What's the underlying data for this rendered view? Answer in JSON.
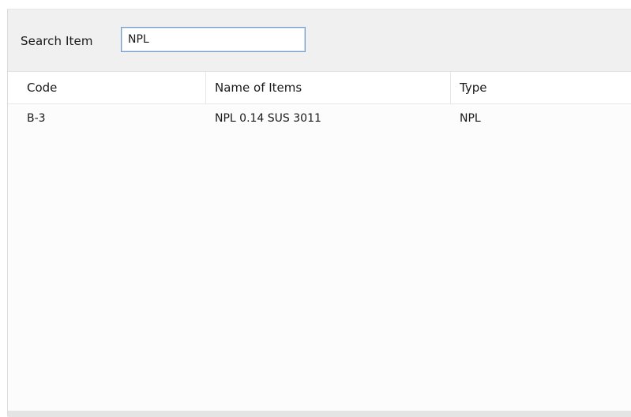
{
  "search": {
    "label": "Search Item",
    "value": "NPL"
  },
  "grid": {
    "columns": [
      "Code",
      "Name of Items",
      "Type"
    ],
    "rows": [
      {
        "code": "B-3",
        "name": "NPL 0.14 SUS 3011",
        "type": "NPL"
      }
    ]
  }
}
